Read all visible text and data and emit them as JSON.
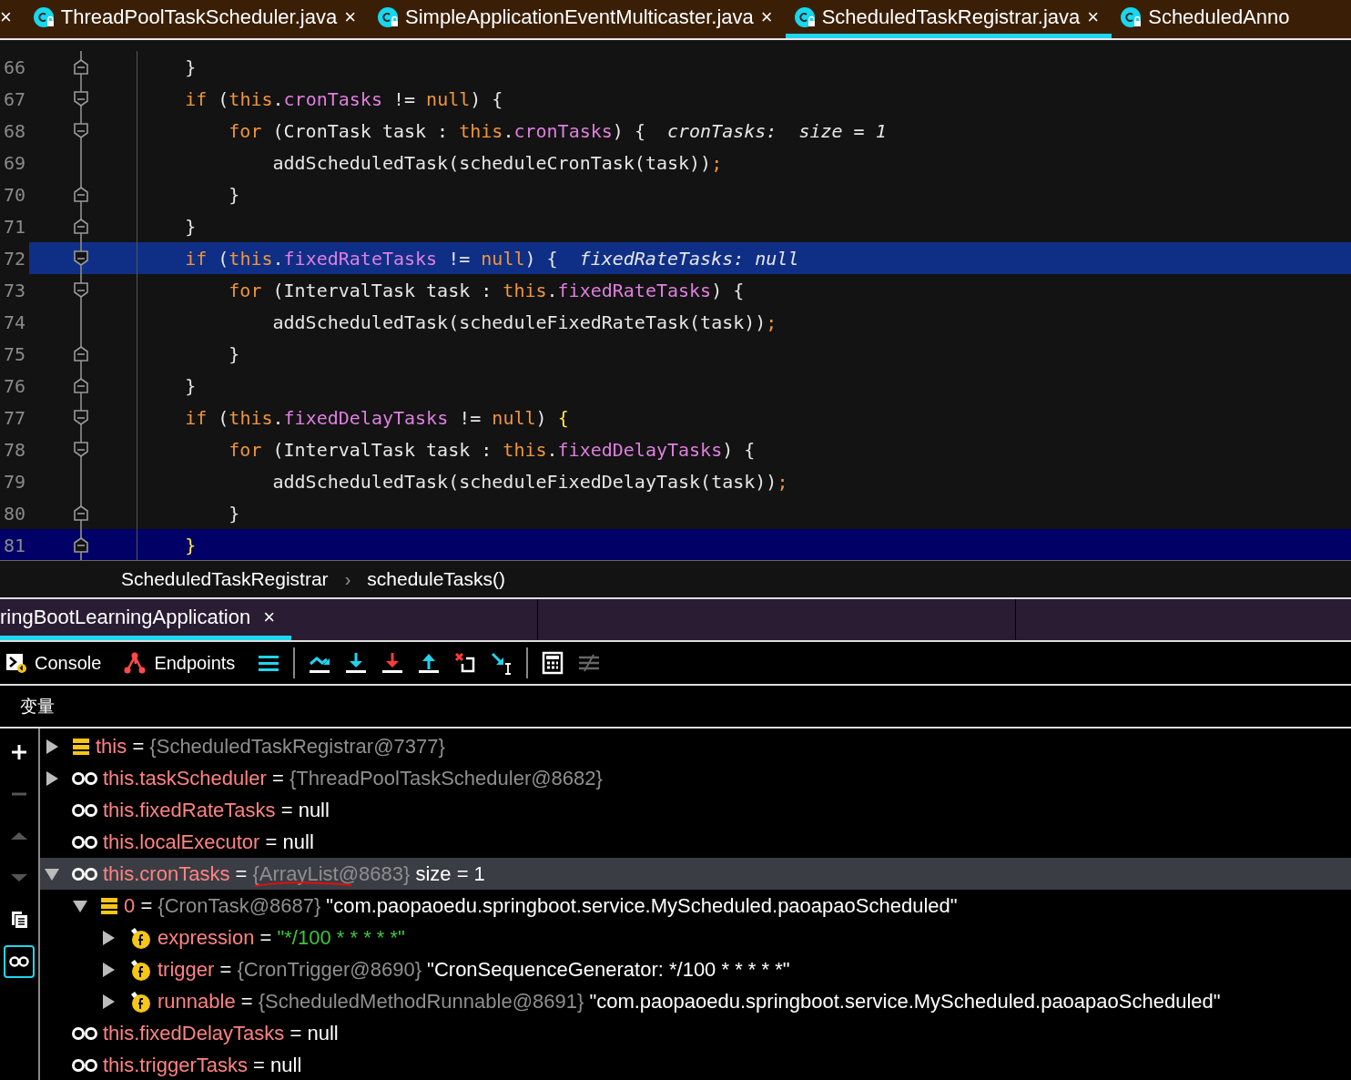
{
  "editor_tabs": [
    {
      "kind": "partial",
      "close": "×",
      "selected": false
    },
    {
      "kind": "file",
      "label": "ThreadPoolTaskScheduler.java",
      "close": "×",
      "selected": false
    },
    {
      "kind": "file",
      "label": "SimpleApplicationEventMulticaster.java",
      "close": "×",
      "selected": false
    },
    {
      "kind": "file",
      "label": "ScheduledTaskRegistrar.java",
      "close": "×",
      "selected": true
    },
    {
      "kind": "file",
      "label": "ScheduledAnno",
      "selected": false
    }
  ],
  "code_lines": [
    {
      "number": "66",
      "fold": {
        "kind": "end"
      },
      "execution_point": false,
      "caret_line": false,
      "tokens": [
        {
          "text": "    }",
          "kind": "plain"
        }
      ]
    },
    {
      "number": "67",
      "fold": {
        "kind": "start"
      },
      "execution_point": false,
      "caret_line": false,
      "tokens": [
        {
          "text": "    if",
          "kind": "keyword"
        },
        {
          "text": " (",
          "kind": "plain"
        },
        {
          "text": "this",
          "kind": "keyword"
        },
        {
          "text": ".",
          "kind": "plain"
        },
        {
          "text": "cronTasks",
          "kind": "field"
        },
        {
          "text": " != ",
          "kind": "plain"
        },
        {
          "text": "null",
          "kind": "keyword"
        },
        {
          "text": ") {",
          "kind": "plain"
        }
      ]
    },
    {
      "number": "68",
      "fold": {
        "kind": "start"
      },
      "execution_point": false,
      "caret_line": false,
      "tokens": [
        {
          "text": "        for",
          "kind": "keyword"
        },
        {
          "text": " (CronTask task : ",
          "kind": "plain"
        },
        {
          "text": "this",
          "kind": "keyword"
        },
        {
          "text": ".",
          "kind": "plain"
        },
        {
          "text": "cronTasks",
          "kind": "field"
        },
        {
          "text": ") {",
          "kind": "plain"
        }
      ],
      "hint": "cronTasks:  size = 1"
    },
    {
      "number": "69",
      "execution_point": false,
      "caret_line": false,
      "tokens": [
        {
          "text": "            addScheduledTask(scheduleCronTask(task))",
          "kind": "plain"
        },
        {
          "text": ";",
          "kind": "keyword"
        }
      ]
    },
    {
      "number": "70",
      "fold": {
        "kind": "end"
      },
      "execution_point": false,
      "caret_line": false,
      "tokens": [
        {
          "text": "        }",
          "kind": "plain"
        }
      ]
    },
    {
      "number": "71",
      "fold": {
        "kind": "end"
      },
      "execution_point": false,
      "caret_line": false,
      "tokens": [
        {
          "text": "    }",
          "kind": "plain"
        }
      ]
    },
    {
      "number": "72",
      "fold": {
        "kind": "start"
      },
      "execution_point": true,
      "caret_line": false,
      "tokens": [
        {
          "text": "    if",
          "kind": "keyword"
        },
        {
          "text": " (",
          "kind": "plain"
        },
        {
          "text": "this",
          "kind": "keyword"
        },
        {
          "text": ".",
          "kind": "plain"
        },
        {
          "text": "fixedRateTasks",
          "kind": "field"
        },
        {
          "text": " != ",
          "kind": "plain"
        },
        {
          "text": "null",
          "kind": "keyword"
        },
        {
          "text": ") {",
          "kind": "plain"
        }
      ],
      "hint": "fixedRateTasks: null"
    },
    {
      "number": "73",
      "fold": {
        "kind": "start"
      },
      "execution_point": false,
      "caret_line": false,
      "tokens": [
        {
          "text": "        for",
          "kind": "keyword"
        },
        {
          "text": " (IntervalTask task : ",
          "kind": "plain"
        },
        {
          "text": "this",
          "kind": "keyword"
        },
        {
          "text": ".",
          "kind": "plain"
        },
        {
          "text": "fixedRateTasks",
          "kind": "field"
        },
        {
          "text": ") {",
          "kind": "plain"
        }
      ]
    },
    {
      "number": "74",
      "execution_point": false,
      "caret_line": false,
      "tokens": [
        {
          "text": "            addScheduledTask(scheduleFixedRateTask(task))",
          "kind": "plain"
        },
        {
          "text": ";",
          "kind": "keyword"
        }
      ]
    },
    {
      "number": "75",
      "fold": {
        "kind": "end"
      },
      "execution_point": false,
      "caret_line": false,
      "tokens": [
        {
          "text": "        }",
          "kind": "plain"
        }
      ]
    },
    {
      "number": "76",
      "fold": {
        "kind": "end"
      },
      "execution_point": false,
      "caret_line": false,
      "tokens": [
        {
          "text": "    }",
          "kind": "plain"
        }
      ]
    },
    {
      "number": "77",
      "fold": {
        "kind": "start"
      },
      "execution_point": false,
      "caret_line": false,
      "tokens": [
        {
          "text": "    if",
          "kind": "keyword"
        },
        {
          "text": " (",
          "kind": "plain"
        },
        {
          "text": "this",
          "kind": "keyword"
        },
        {
          "text": ".",
          "kind": "plain"
        },
        {
          "text": "fixedDelayTasks",
          "kind": "field"
        },
        {
          "text": " != ",
          "kind": "plain"
        },
        {
          "text": "null",
          "kind": "keyword"
        },
        {
          "text": ") ",
          "kind": "plain"
        },
        {
          "text": "{",
          "kind": "match"
        }
      ]
    },
    {
      "number": "78",
      "fold": {
        "kind": "start"
      },
      "execution_point": false,
      "caret_line": false,
      "tokens": [
        {
          "text": "        for",
          "kind": "keyword"
        },
        {
          "text": " (IntervalTask task : ",
          "kind": "plain"
        },
        {
          "text": "this",
          "kind": "keyword"
        },
        {
          "text": ".",
          "kind": "plain"
        },
        {
          "text": "fixedDelayTasks",
          "kind": "field"
        },
        {
          "text": ") {",
          "kind": "plain"
        }
      ]
    },
    {
      "number": "79",
      "execution_point": false,
      "caret_line": false,
      "tokens": [
        {
          "text": "            addScheduledTask(scheduleFixedDelayTask(task))",
          "kind": "plain"
        },
        {
          "text": ";",
          "kind": "keyword"
        }
      ]
    },
    {
      "number": "80",
      "fold": {
        "kind": "end"
      },
      "execution_point": false,
      "caret_line": false,
      "tokens": [
        {
          "text": "        }",
          "kind": "plain"
        }
      ]
    },
    {
      "number": "81",
      "fold": {
        "kind": "end"
      },
      "execution_point": false,
      "caret_line": true,
      "tokens": [
        {
          "text": "    }",
          "kind": "match"
        }
      ]
    }
  ],
  "breadcrumb": {
    "items": [
      "ScheduledTaskRegistrar",
      "scheduleTasks()"
    ],
    "separator": "›"
  },
  "debug_tabs": [
    {
      "label": "ringBootLearningApplication",
      "close": "×",
      "selected": true
    }
  ],
  "debug_toolbar": {
    "buttons": [
      {
        "kind": "console",
        "label": "Console"
      },
      {
        "kind": "endpoints",
        "label": "Endpoints"
      }
    ]
  },
  "variables_header": "变量",
  "side_toolbar": [
    {
      "kind": "add",
      "disabled": false,
      "selected": false
    },
    {
      "kind": "remove",
      "disabled": true,
      "selected": false
    },
    {
      "kind": "up",
      "disabled": true,
      "selected": false
    },
    {
      "kind": "down",
      "disabled": true,
      "selected": false
    },
    {
      "kind": "copy",
      "disabled": false,
      "selected": false
    },
    {
      "kind": "watches",
      "disabled": false,
      "selected": true
    }
  ],
  "variables": [
    {
      "kind": "object",
      "expandable": true,
      "expanded": false,
      "selected": false,
      "name": "this",
      "assign": "=",
      "value": [
        {
          "text": "{ScheduledTaskRegistrar@7377}",
          "kind": "ref"
        }
      ]
    },
    {
      "kind": "watch",
      "expandable": true,
      "expanded": false,
      "selected": false,
      "name": "this.taskScheduler",
      "assign": "=",
      "value": [
        {
          "text": "{ThreadPoolTaskScheduler@8682}",
          "kind": "ref"
        }
      ]
    },
    {
      "kind": "watch",
      "expandable": false,
      "selected": false,
      "name": "this.fixedRateTasks",
      "assign": "=",
      "value": [
        {
          "text": "null",
          "kind": "plain"
        }
      ]
    },
    {
      "kind": "watch",
      "expandable": false,
      "selected": false,
      "name": "this.localExecutor",
      "assign": "=",
      "value": [
        {
          "text": "null",
          "kind": "plain"
        }
      ]
    },
    {
      "kind": "watch",
      "expandable": true,
      "expanded": true,
      "selected": true,
      "name": "this.cronTasks",
      "assign": "=",
      "value": [
        {
          "text": "{ArrayList@8683}",
          "kind": "ref",
          "squiggle": true
        },
        {
          "text": " size = 1",
          "kind": "plain"
        }
      ],
      "children": [
        {
          "kind": "object",
          "expandable": true,
          "expanded": true,
          "selected": false,
          "name": "0",
          "assign": "=",
          "value": [
            {
              "text": "{CronTask@8687}",
              "kind": "ref"
            },
            {
              "text": " \"com.paopaoedu.springboot.service.MyScheduled.paoapaoScheduled\"",
              "kind": "plain"
            }
          ],
          "children": [
            {
              "kind": "field",
              "expandable": true,
              "expanded": false,
              "selected": false,
              "name": "expression",
              "assign": "=",
              "value": [
                {
                  "text": "\"*/100 * * * * *\"",
                  "kind": "string"
                }
              ]
            },
            {
              "kind": "field",
              "expandable": true,
              "expanded": false,
              "selected": false,
              "name": "trigger",
              "assign": "=",
              "value": [
                {
                  "text": "{CronTrigger@8690}",
                  "kind": "ref"
                },
                {
                  "text": " \"CronSequenceGenerator: */100 * * * * *\"",
                  "kind": "plain"
                }
              ]
            },
            {
              "kind": "field",
              "expandable": true,
              "expanded": false,
              "selected": false,
              "name": "runnable",
              "assign": "=",
              "value": [
                {
                  "text": "{ScheduledMethodRunnable@8691}",
                  "kind": "ref"
                },
                {
                  "text": " \"com.paopaoedu.springboot.service.MyScheduled.paoapaoScheduled\"",
                  "kind": "plain"
                }
              ]
            }
          ]
        }
      ]
    },
    {
      "kind": "watch",
      "expandable": false,
      "selected": false,
      "name": "this.fixedDelayTasks",
      "assign": "=",
      "value": [
        {
          "text": "null",
          "kind": "plain"
        }
      ]
    },
    {
      "kind": "watch",
      "expandable": false,
      "selected": false,
      "name": "this.triggerTasks",
      "assign": "=",
      "value": [
        {
          "text": "null",
          "kind": "plain"
        }
      ]
    }
  ]
}
